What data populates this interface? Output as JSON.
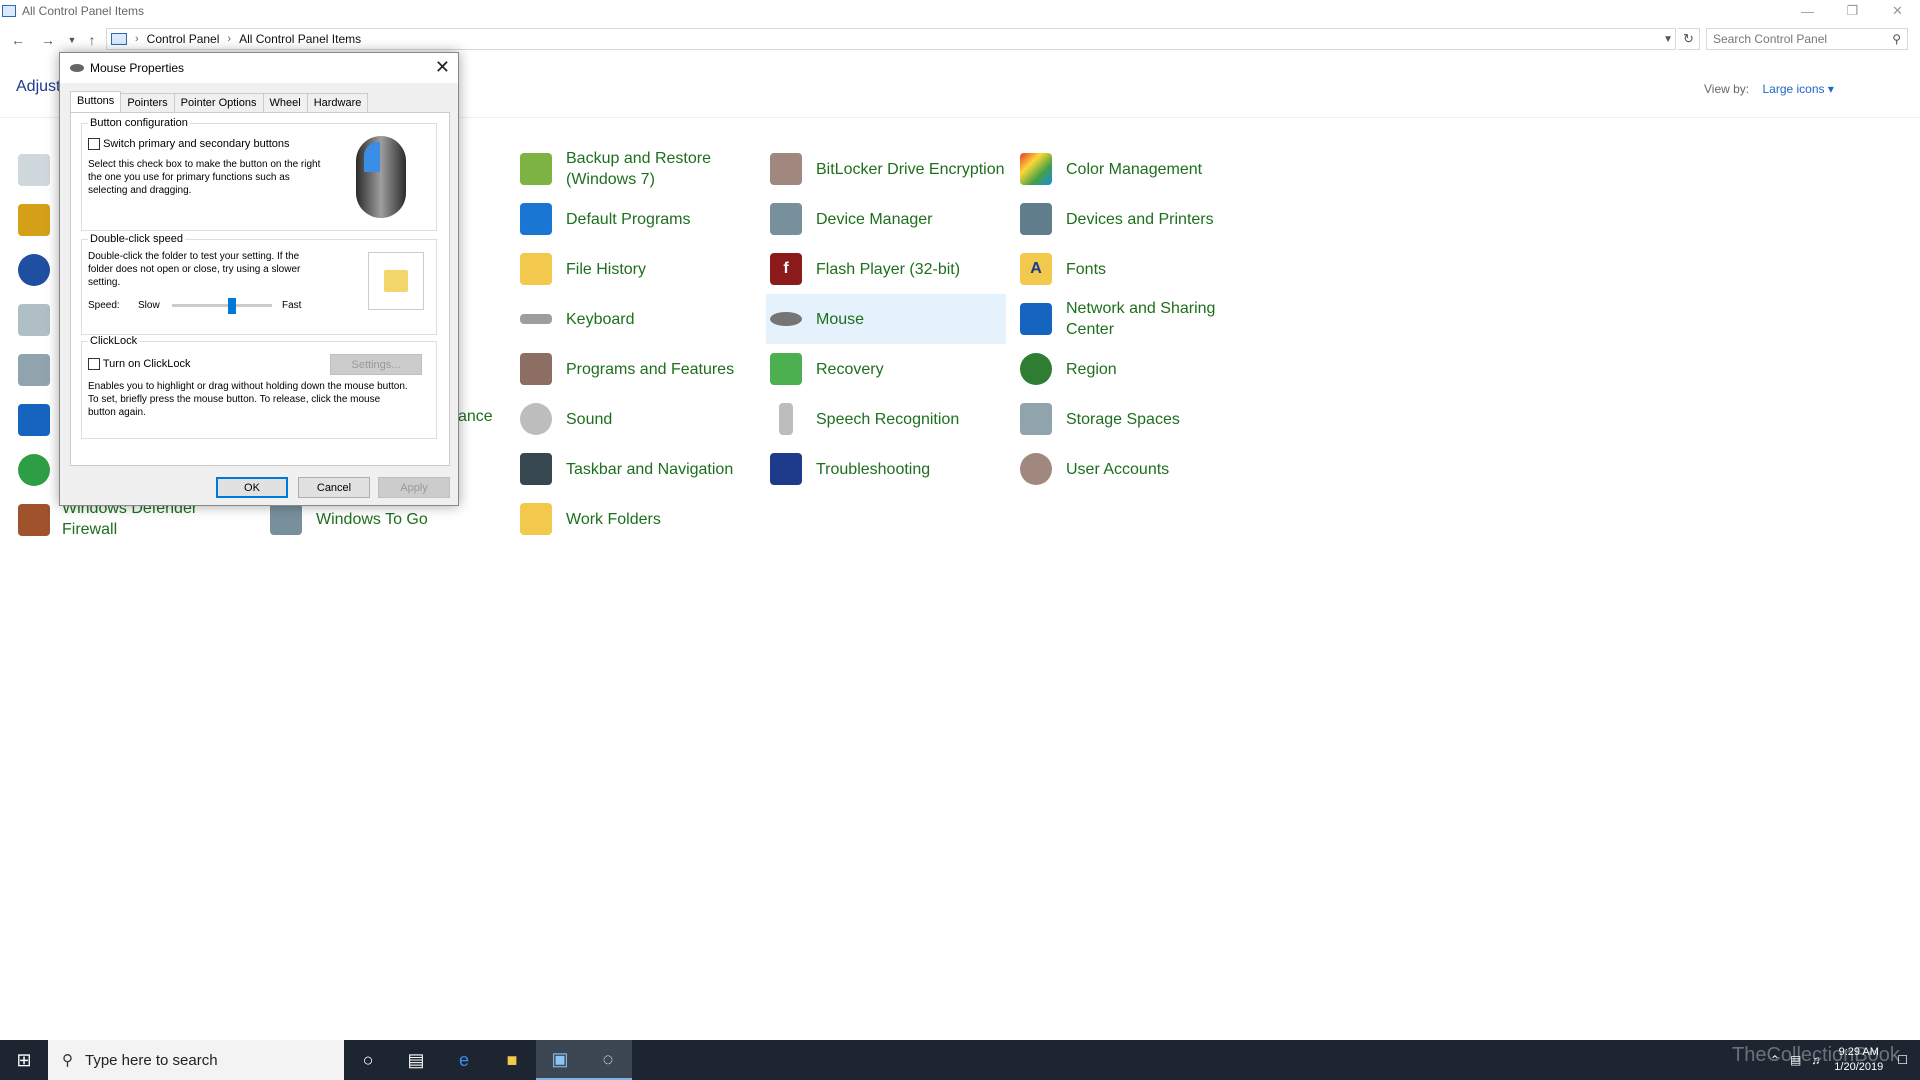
{
  "window": {
    "title": "All Control Panel Items",
    "minimize": "—",
    "restore": "❐",
    "close": "✕"
  },
  "address": {
    "crumbs": [
      "Control Panel",
      "All Control Panel Items"
    ],
    "search_placeholder": "Search Control Panel"
  },
  "header": {
    "adjust_label": "Adjust",
    "view_by_label": "View by:",
    "view_by_value": "Large icons ▾"
  },
  "items": {
    "col1": [
      {
        "label": "Backup and Restore (Windows 7)",
        "icon": "backup-icon"
      },
      {
        "label": "Default Programs",
        "icon": "default-programs-icon"
      },
      {
        "label": "File History",
        "icon": "file-history-icon"
      },
      {
        "label": "Keyboard",
        "icon": "keyboard-icon"
      },
      {
        "label": "Programs and Features",
        "icon": "programs-features-icon"
      },
      {
        "label": "Sound",
        "icon": "sound-icon"
      },
      {
        "label": "Taskbar and Navigation",
        "icon": "taskbar-icon"
      },
      {
        "label": "Work Folders",
        "icon": "work-folders-icon"
      }
    ],
    "col2": [
      {
        "label": "BitLocker Drive Encryption",
        "icon": "bitlocker-icon"
      },
      {
        "label": "Device Manager",
        "icon": "device-manager-icon"
      },
      {
        "label": "Flash Player (32-bit)",
        "icon": "flash-icon"
      },
      {
        "label": "Mouse",
        "icon": "mouse-icon"
      },
      {
        "label": "Recovery",
        "icon": "recovery-icon"
      },
      {
        "label": "Speech Recognition",
        "icon": "microphone-icon"
      },
      {
        "label": "Troubleshooting",
        "icon": "troubleshooting-icon"
      }
    ],
    "col3": [
      {
        "label": "Color Management",
        "icon": "color-management-icon"
      },
      {
        "label": "Devices and Printers",
        "icon": "printer-icon"
      },
      {
        "label": "Fonts",
        "icon": "fonts-icon"
      },
      {
        "label": "Network and Sharing Center",
        "icon": "network-icon"
      },
      {
        "label": "Region",
        "icon": "globe-icon"
      },
      {
        "label": "Storage Spaces",
        "icon": "storage-icon"
      },
      {
        "label": "User Accounts",
        "icon": "users-icon"
      }
    ],
    "partial": {
      "firewall": "Windows Defender Firewall",
      "windows_to_go": "Windows To Go",
      "ance": "ance"
    }
  },
  "dialog": {
    "title": "Mouse Properties",
    "tabs": [
      "Buttons",
      "Pointers",
      "Pointer Options",
      "Wheel",
      "Hardware"
    ],
    "button_config": {
      "title": "Button configuration",
      "checkbox": "Switch primary and secondary buttons",
      "description": "Select this check box to make the button on the right the one you use for primary functions such as selecting and dragging."
    },
    "double_click": {
      "title": "Double-click speed",
      "description": "Double-click the folder to test your setting. If the folder does not open or close, try using a slower setting.",
      "speed_label": "Speed:",
      "slow": "Slow",
      "fast": "Fast",
      "slider_value": 0.6
    },
    "clicklock": {
      "title": "ClickLock",
      "checkbox": "Turn on ClickLock",
      "settings_button": "Settings...",
      "description": "Enables you to highlight or drag without holding down the mouse button. To set, briefly press the mouse button. To release, click the mouse button again."
    },
    "ok": "OK",
    "cancel": "Cancel",
    "apply": "Apply"
  },
  "taskbar": {
    "search_placeholder": "Type here to search",
    "time": "9:29 AM",
    "date": "1/20/2019",
    "watermark": "TheCollectionBook"
  }
}
